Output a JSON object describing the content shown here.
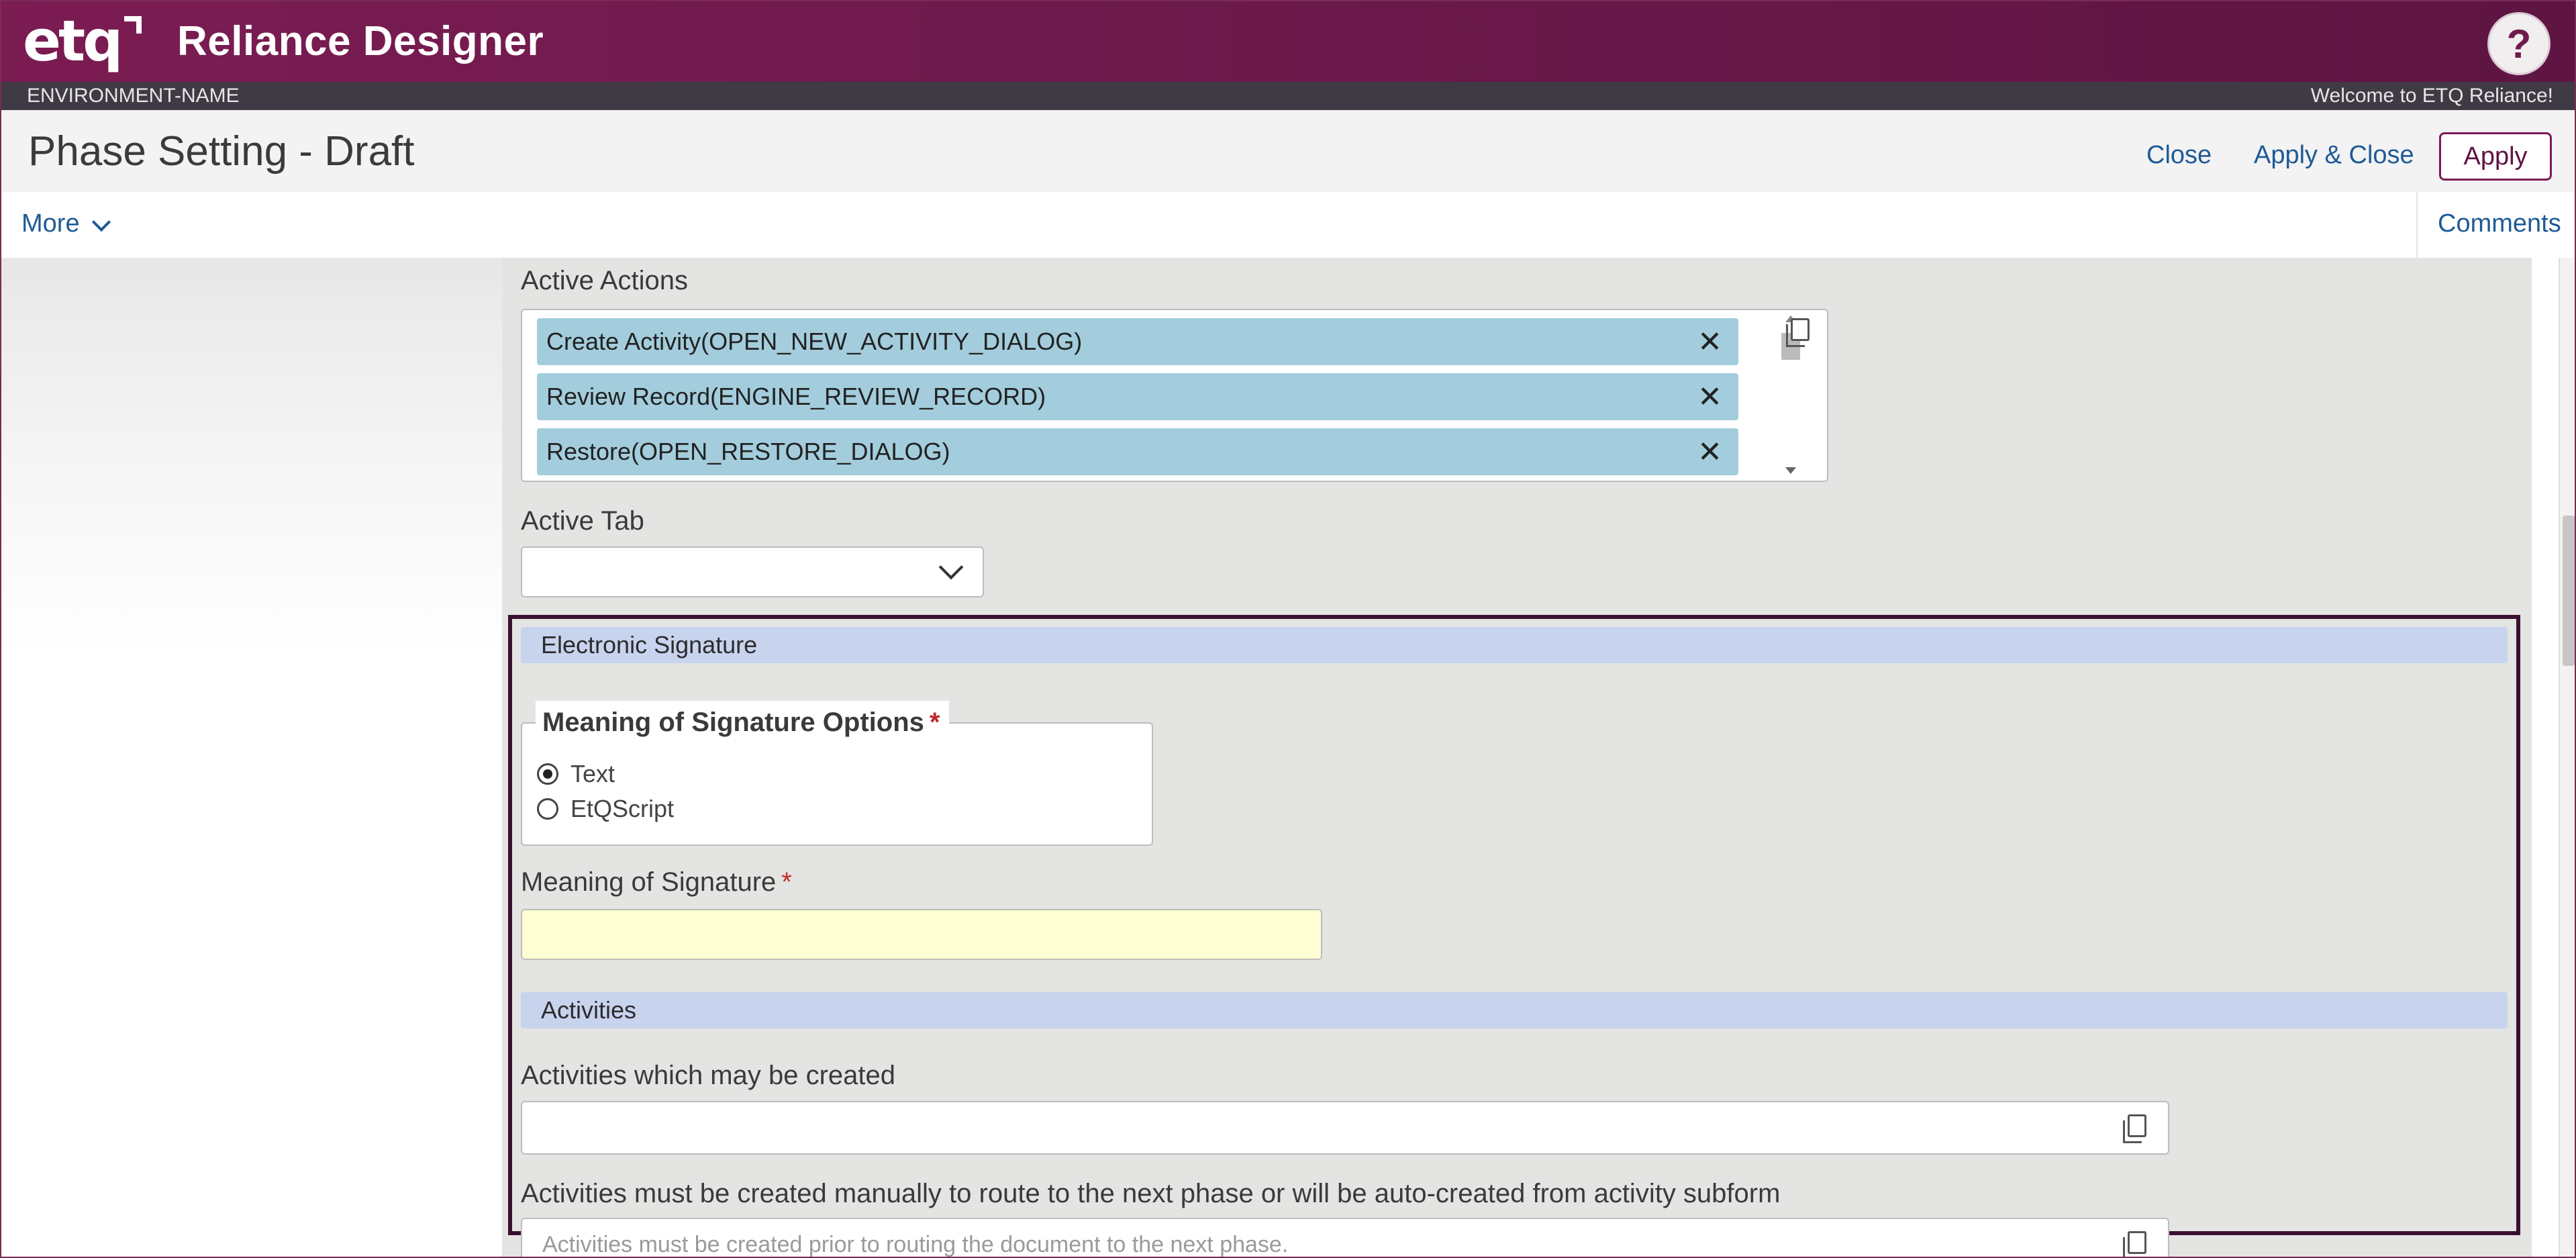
{
  "header": {
    "logo_text": "etq",
    "app_title": "Reliance Designer",
    "help_label": "?"
  },
  "env": {
    "name": "ENVIRONMENT-NAME",
    "welcome": "Welcome to ETQ Reliance!"
  },
  "titlebar": {
    "page_title": "Phase Setting - Draft",
    "close_label": "Close",
    "apply_close_label": "Apply & Close",
    "apply_label": "Apply"
  },
  "menubar": {
    "more_label": "More",
    "comments_label": "Comments"
  },
  "form": {
    "active_actions_label": "Active Actions",
    "active_actions": [
      "Create Activity(OPEN_NEW_ACTIVITY_DIALOG)",
      "Review Record(ENGINE_REVIEW_RECORD)",
      "Restore(OPEN_RESTORE_DIALOG)"
    ],
    "active_tab_label": "Active Tab",
    "active_tab_value": "",
    "esig_section": "Electronic Signature",
    "signature_options_label": "Meaning of Signature Options",
    "signature_options": [
      {
        "label": "Text",
        "checked": true
      },
      {
        "label": "EtQScript",
        "checked": false
      }
    ],
    "meaning_label": "Meaning of Signature",
    "meaning_value": "",
    "activities_section": "Activities",
    "activities_created_label": "Activities which may be created",
    "activities_created_value": "",
    "activities_manual_label": "Activities must be created manually to route to the next phase or will be auto-created from activity subform",
    "activities_manual_placeholder": "Activities must be created prior to routing the document to the next phase.",
    "required_mark": "*"
  },
  "colors": {
    "brand": "#7b1c53",
    "chip": "#a3cddd",
    "section_header": "#c8d3ee",
    "required_input": "#fefed5",
    "link": "#1f5a96"
  }
}
